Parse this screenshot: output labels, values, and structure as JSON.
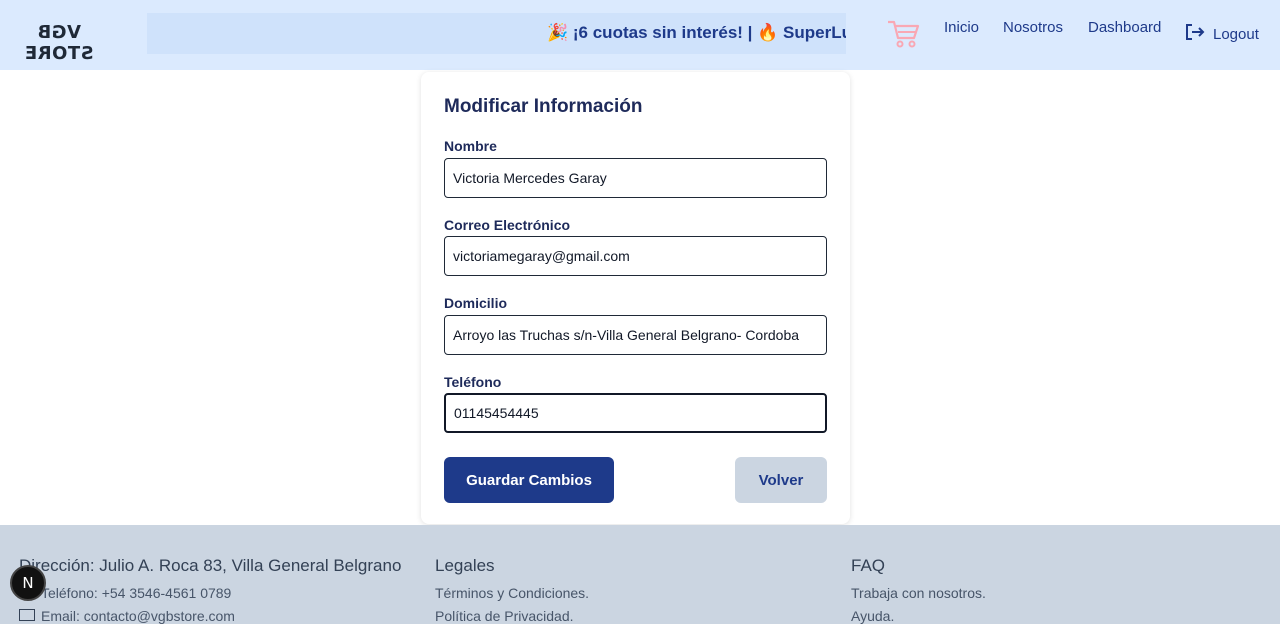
{
  "navbar": {
    "brand": "VGB STORE",
    "promo_text": "🎉 ¡6 cuotas sin interés! | 🔥 SuperLu",
    "links": [
      {
        "label": "Inicio"
      },
      {
        "label": "Nosotros"
      },
      {
        "label": "Dashboard"
      }
    ],
    "logout_label": "Logout",
    "cart_icon": "cart-icon",
    "logout_icon": "logout-icon"
  },
  "form": {
    "title": "Modificar Información",
    "fields": [
      {
        "label": "Nombre",
        "value": "Victoria Mercedes Garay"
      },
      {
        "label": "Correo Electrónico",
        "value": "victoriamegaray@gmail.com"
      },
      {
        "label": "Domicilio",
        "value": "Arroyo las Truchas s/n-Villa General Belgrano- Cordoba"
      },
      {
        "label": "Teléfono",
        "value": "01145454445"
      }
    ],
    "save_label": "Guardar Cambios",
    "back_label": "Volver"
  },
  "footer": {
    "contact": {
      "heading": "Dirección: Julio A. Roca 83, Villa General Belgrano",
      "phone": "Teléfono: +54 3546-4561 0789",
      "email": "Email: contacto@vgbstore.com"
    },
    "legal": {
      "heading": "Legales",
      "items": [
        "Términos y Condiciones.",
        "Política de Privacidad."
      ]
    },
    "faq": {
      "heading": "FAQ",
      "items": [
        "Trabaja con nosotros.",
        "Ayuda."
      ]
    }
  },
  "dev_badge": "N",
  "colors": {
    "navbar_bg": "#dbeafe",
    "primary": "#1e3a8a",
    "secondary_button": "#cbd5e1",
    "footer_bg": "#cbd5e1",
    "cart": "#f9a8b4"
  }
}
